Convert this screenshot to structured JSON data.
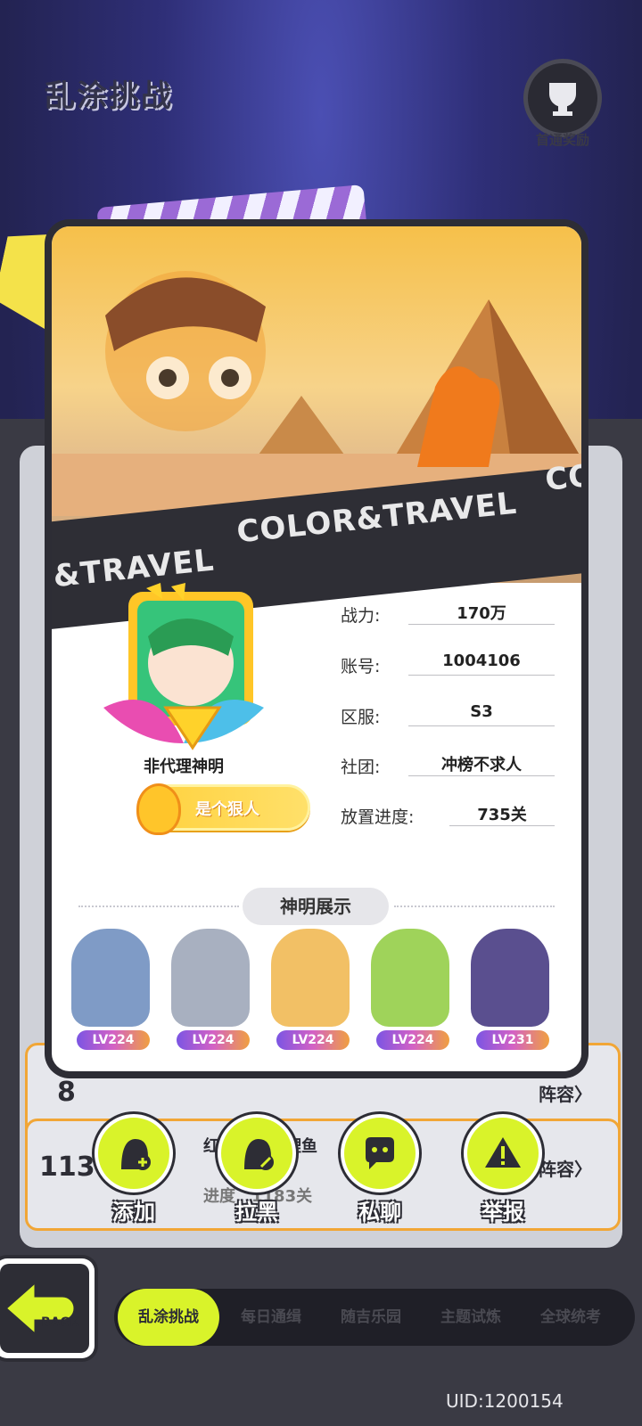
{
  "header": {
    "title": "乱涂挑战",
    "reward_label": "首通奖励",
    "reward_icon": "trophy-icon"
  },
  "banner": {
    "strip_text_left": "&TRAVEL",
    "strip_text_main": "COLOR&TRAVEL",
    "strip_text_right": "CO"
  },
  "profile": {
    "name": "非代理神明",
    "title_badge": "是个狠人",
    "fields": [
      {
        "label": "战力:",
        "value": "170万"
      },
      {
        "label": "账号:",
        "value": "1004106"
      },
      {
        "label": "区服:",
        "value": "S3"
      },
      {
        "label": "社团:",
        "value": "冲榜不求人"
      },
      {
        "label": "放置进度:",
        "value": "735关"
      }
    ]
  },
  "showcase": {
    "title": "神明展示",
    "heroes": [
      {
        "level": "LV224",
        "color": "#7f9bc6"
      },
      {
        "level": "LV224",
        "color": "#a8b0c0"
      },
      {
        "level": "LV224",
        "color": "#f2c065"
      },
      {
        "level": "LV224",
        "color": "#9fd35a"
      },
      {
        "level": "LV231",
        "color": "#5a4f8f"
      }
    ]
  },
  "rows": [
    {
      "rank": "8",
      "lineup": "阵容",
      "name": ""
    },
    {
      "rank": "113",
      "lineup": "阵容",
      "name": "红",
      "extra": "鲤鱼",
      "progress": "进度",
      "progress_val": "1183关"
    }
  ],
  "actions": [
    {
      "label": "添加",
      "icon": "add-friend-icon"
    },
    {
      "label": "拉黑",
      "icon": "block-icon"
    },
    {
      "label": "私聊",
      "icon": "chat-icon"
    },
    {
      "label": "举报",
      "icon": "warning-icon"
    }
  ],
  "back": {
    "label": "BACK"
  },
  "tabs": [
    "乱涂挑战",
    "每日通缉",
    "随吉乐园",
    "主题试炼",
    "全球统考"
  ],
  "uid": "UID:1200154",
  "colors": {
    "accent": "#d9f32a",
    "dark": "#2d2d35",
    "banner": "#f6c04a"
  }
}
